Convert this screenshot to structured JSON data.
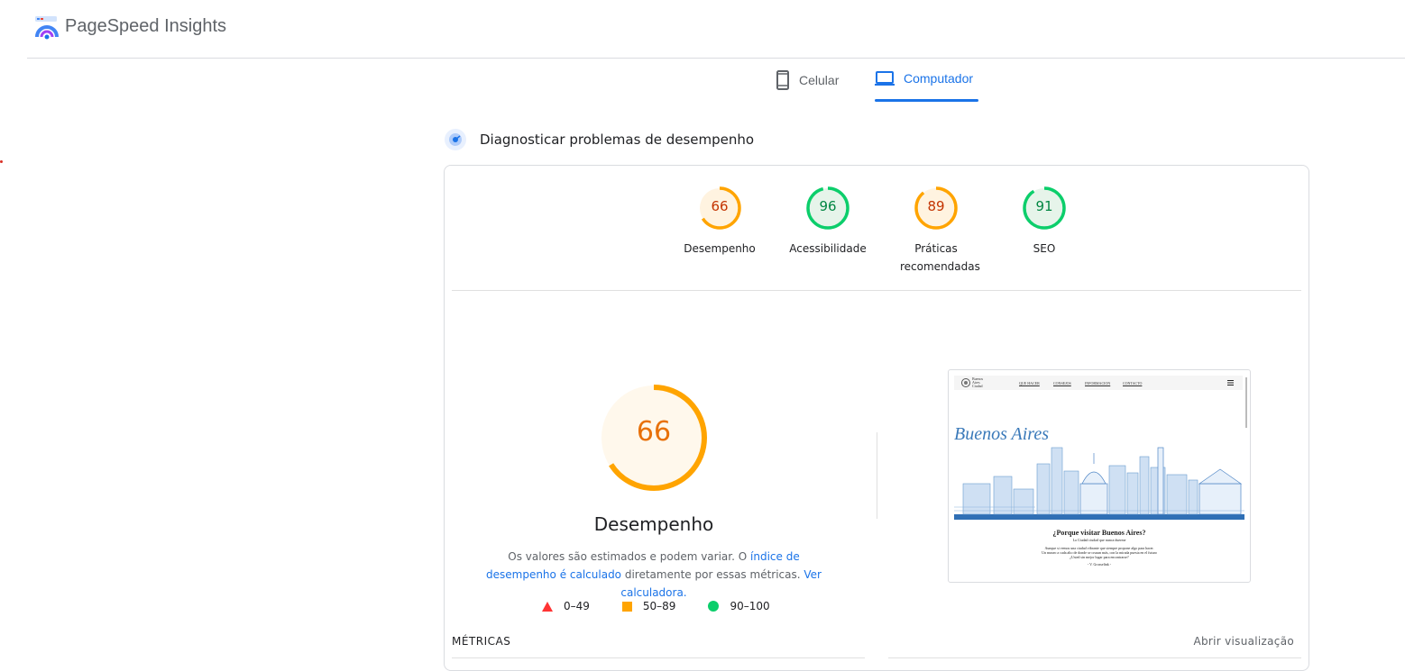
{
  "app": {
    "title": "PageSpeed Insights"
  },
  "tabs": [
    {
      "label": "Celular",
      "icon": "phone-icon",
      "selected": false
    },
    {
      "label": "Computador",
      "icon": "laptop-icon",
      "selected": true
    }
  ],
  "section": {
    "title": "Diagnosticar problemas de desempenho",
    "icon": "diagnose-icon"
  },
  "scores": [
    {
      "value": "66",
      "label": "Desempenho",
      "status": "average"
    },
    {
      "value": "96",
      "label": "Acessibilidade",
      "status": "good"
    },
    {
      "value": "89",
      "label": "Práticas recomendadas",
      "status": "average"
    },
    {
      "value": "91",
      "label": "SEO",
      "status": "good"
    }
  ],
  "performance": {
    "score": "66",
    "label": "Desempenho",
    "desc_part1": "Os valores são estimados e podem variar. O ",
    "desc_link1": "índice de desempenho é calculado",
    "desc_part2": " diretamente por essas métricas. ",
    "desc_link2": "Ver calculadora."
  },
  "legend": [
    {
      "range": "0–49",
      "shape": "triangle",
      "color": "#ff3333"
    },
    {
      "range": "50–89",
      "shape": "square",
      "color": "#ffa400"
    },
    {
      "range": "90–100",
      "shape": "circle",
      "color": "#0cce6b"
    }
  ],
  "preview": {
    "brand_line1": "Buenos",
    "brand_line2": "Aires",
    "brand_line3": "Ciudad",
    "nav": [
      "QUE HACER",
      "CONSEJOS",
      "INFORMACION",
      "CONTACTO"
    ],
    "hero_title": "Buenos Aires",
    "heading": "¿Porque visitar Buenos Aires?",
    "sub": "La Ciudad ciudad que nunca duerme",
    "para1": "Aunque si vemos una ciudad vibrante que siempre propone algo para hacer.",
    "para2": "Un museo a cada alto de donde se cruzan más, con la mirada puesta en el futuro",
    "para3": "¿Usted sin mejor lugar para encontrarse?",
    "sign": "- V. Grosselink -"
  },
  "metrics": {
    "label": "MÉTRICAS",
    "open_view": "Abrir visualização"
  },
  "colors": {
    "accent": "#1a73e8",
    "average": "#ffa400",
    "good": "#0cce6b",
    "poor": "#ff3333"
  }
}
